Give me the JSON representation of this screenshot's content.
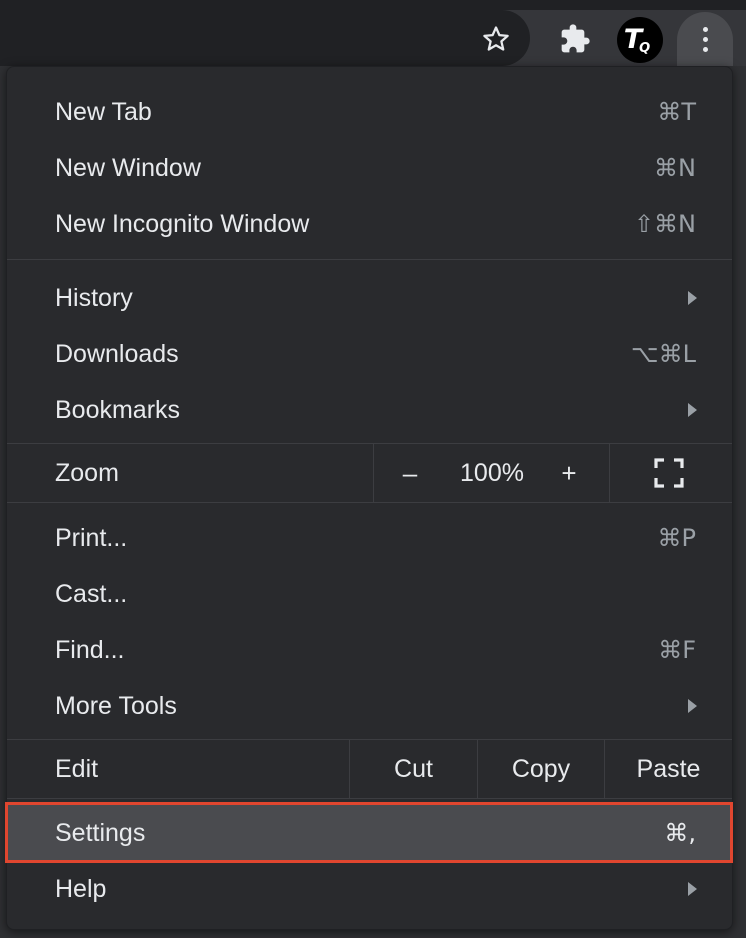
{
  "toolbar": {
    "bookmark_icon": "star-outline-icon",
    "extensions_icon": "puzzle-piece-icon",
    "profile": {
      "letter_main": "T",
      "letter_sub": "Q"
    },
    "menu_icon": "three-dots-vertical-icon"
  },
  "menu": {
    "new_tab": {
      "label": "New Tab",
      "shortcut": "⌘T"
    },
    "new_window": {
      "label": "New Window",
      "shortcut": "⌘N"
    },
    "new_incognito": {
      "label": "New Incognito Window",
      "shortcut": "⇧⌘N"
    },
    "history": {
      "label": "History"
    },
    "downloads": {
      "label": "Downloads",
      "shortcut": "⌥⌘L"
    },
    "bookmarks": {
      "label": "Bookmarks"
    },
    "zoom": {
      "label": "Zoom",
      "minus": "–",
      "value": "100%",
      "plus": "+"
    },
    "print": {
      "label": "Print...",
      "shortcut": "⌘P"
    },
    "cast": {
      "label": "Cast..."
    },
    "find": {
      "label": "Find...",
      "shortcut": "⌘F"
    },
    "more_tools": {
      "label": "More Tools"
    },
    "edit": {
      "label": "Edit",
      "cut": "Cut",
      "copy": "Copy",
      "paste": "Paste"
    },
    "settings": {
      "label": "Settings",
      "shortcut": "⌘,",
      "highlighted": true
    },
    "help": {
      "label": "Help"
    }
  },
  "colors": {
    "menu_bg": "#292a2d",
    "text": "#e8eaed",
    "shortcut_text": "#9aa0a6",
    "highlight_bg": "#4a4b4f",
    "annotation_border": "#e0462f"
  }
}
